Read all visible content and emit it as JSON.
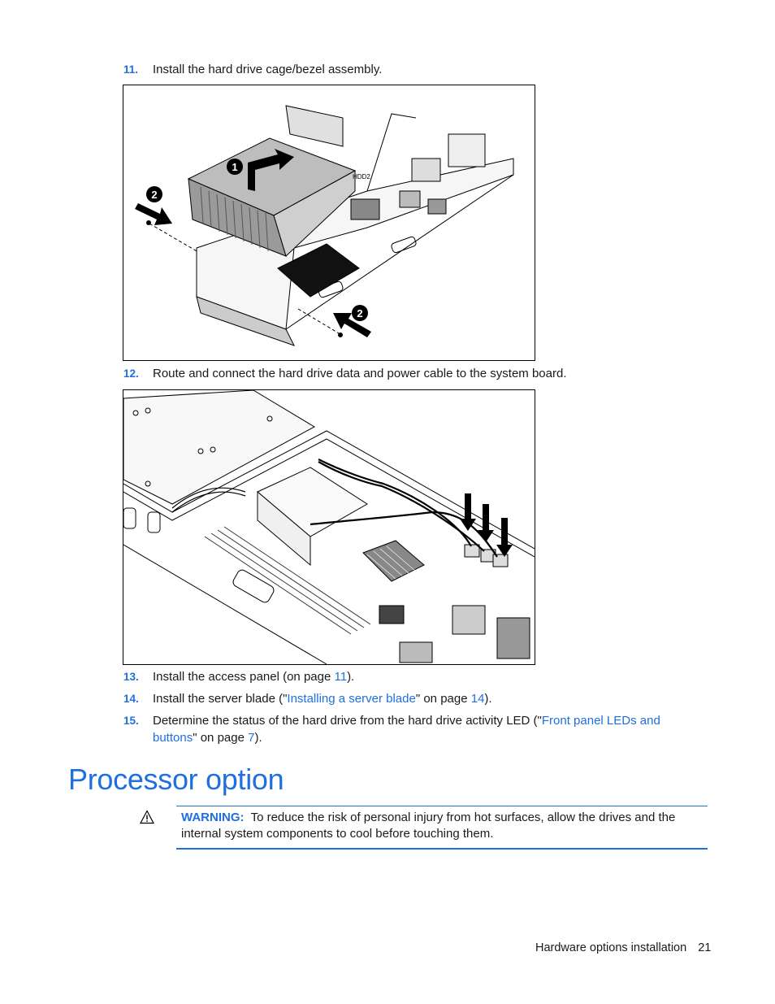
{
  "steps": [
    {
      "number": "11.",
      "text": "Install the hard drive cage/bezel assembly."
    },
    {
      "number": "12.",
      "text": "Route and connect the hard drive data and power cable to the system board."
    },
    {
      "number": "13.",
      "text_before": "Install the access panel (on page ",
      "link_page": "11",
      "text_after": ")."
    },
    {
      "number": "14.",
      "text_before": "Install the server blade (\"",
      "link_text": "Installing a server blade",
      "text_middle": "\" on page ",
      "link_page": "14",
      "text_after": ")."
    },
    {
      "number": "15.",
      "text_before": "Determine the status of the hard drive from the hard drive activity LED (\"",
      "link_text_line1": "Front panel LEDs and",
      "link_text_line2": "buttons",
      "text_middle": "\" on page ",
      "link_page": "7",
      "text_after": ")."
    }
  ],
  "figures": [
    {
      "description": "Hard drive cage/bezel assembly being installed into server blade",
      "callouts": [
        "1",
        "2",
        "2"
      ],
      "label": "HDD2"
    },
    {
      "description": "Hard drive data and power cable routed to system board connectors"
    }
  ],
  "section": {
    "title": "Processor option",
    "warning": {
      "label": "WARNING:",
      "text_line1": "To reduce the risk of personal injury from hot surfaces, allow the drives and the",
      "text_line2": "internal system components to cool before touching them."
    }
  },
  "footer": {
    "chapter": "Hardware options installation",
    "page_number": "21"
  },
  "colors": {
    "accent": "#1f6fe0",
    "text": "#1a1a1a"
  }
}
